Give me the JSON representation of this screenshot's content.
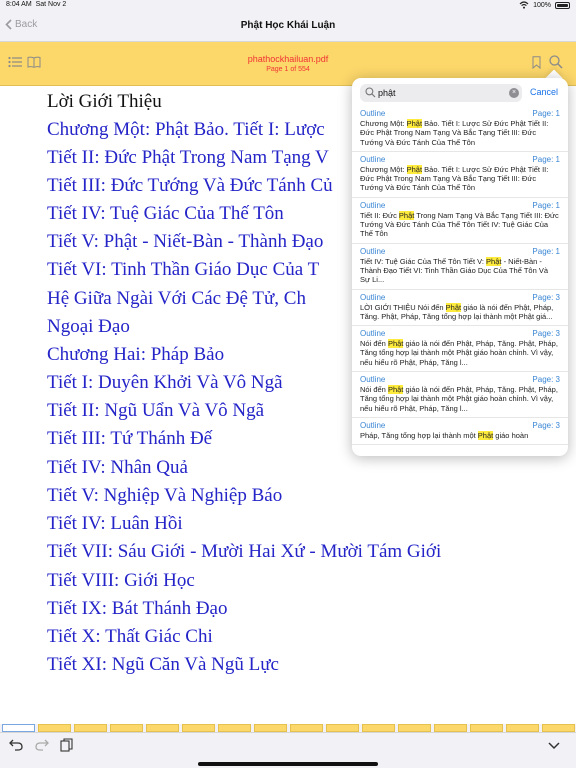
{
  "status_bar": {
    "time": "8:04 AM",
    "date": "Sat Nov 2",
    "battery": "100%"
  },
  "nav": {
    "back_label": "Back",
    "title": "Phật Học Khái Luận"
  },
  "pdf_toolbar": {
    "file_name": "phathockhailuan.pdf",
    "page_indicator": "Page 1 of 554"
  },
  "document": {
    "lines": [
      "Lời Giới Thiệu",
      "Chương Một: Phật Bảo. Tiết I: Lược",
      "Tiết II: Đức Phật Trong Nam Tạng V",
      "Tiết III: Đức Tướng Và Đức Tánh Củ",
      "Tiết IV: Tuệ Giác Của Thế Tôn",
      "Tiết V: Phật - Niết-Bàn - Thành Đạo",
      "Tiết VI: Tinh Thần Giáo Dục Của T",
      "Hệ Giữa Ngài Với Các Đệ Tử, Ch",
      "Ngoại Đạo",
      "Chương Hai: Pháp Bảo",
      "Tiết I: Duyên Khởi Và Vô Ngã",
      "Tiết II: Ngũ Uẩn Và Vô Ngã",
      "Tiết III: Tứ Thánh Đế",
      "Tiết IV: Nhân Quả",
      "Tiết V: Nghiệp Và Nghiệp Báo",
      "Tiết IV: Luân Hồi",
      "Tiết VII: Sáu Giới - Mười Hai Xứ - Mười Tám Giới",
      "Tiết VIII: Giới Học",
      "Tiết IX: Bát Thánh Đạo",
      "Tiết X: Thất Giác Chi",
      "Tiết XI: Ngũ Căn Và Ngũ Lực"
    ]
  },
  "search": {
    "query": "phật",
    "cancel_label": "Cancel",
    "results": [
      {
        "source": "Outline",
        "page": "Page: 1",
        "before": "Chương Một: ",
        "match": "Phật",
        "after": " Bảo. Tiết I: Lược Sử Đức Phật Tiết II: Đức Phật Trong Nam Tạng Và Bắc Tạng Tiết III: Đức Tướng Và Đức Tánh Của Thế Tôn"
      },
      {
        "source": "Outline",
        "page": "Page: 1",
        "before": "Chương Một: ",
        "match": "Phật",
        "after": " Bảo. Tiết I: Lược Sử Đức Phật Tiết II: Đức Phật Trong Nam Tạng Và Bắc Tạng Tiết III: Đức Tướng Và Đức Tánh Của Thế Tôn"
      },
      {
        "source": "Outline",
        "page": "Page: 1",
        "before": "Tiết II: Đức ",
        "match": "Phật",
        "after": " Trong Nam Tạng Và Bắc Tạng Tiết III: Đức Tướng Và Đức Tánh Của Thế Tôn Tiết IV: Tuệ Giác Của Thế Tôn"
      },
      {
        "source": "Outline",
        "page": "Page: 1",
        "before": "Tiết IV: Tuệ Giác Của Thế Tôn Tiết V: ",
        "match": "Phật",
        "after": " - Niết-Bàn - Thành Đạo Tiết VI: Tinh Thần Giáo Dục Của Thế Tôn Và Sự Li..."
      },
      {
        "source": "Outline",
        "page": "Page: 3",
        "before": "LỜI GIỚI THIỆU Nói đến ",
        "match": "Phật",
        "after": " giáo là nói đến Phật, Pháp, Tăng. Phật, Pháp, Tăng tổng hợp lại thành một Phật giá..."
      },
      {
        "source": "Outline",
        "page": "Page: 3",
        "before": "Nói đến ",
        "match": "Phật",
        "after": " giáo là nói đến Phật, Pháp, Tăng. Phật, Pháp, Tăng tổng hợp lại thành một Phật giáo hoàn chỉnh. Vì vậy, nếu hiểu rõ Phật, Pháp, Tăng l..."
      },
      {
        "source": "Outline",
        "page": "Page: 3",
        "before": "Nói đến ",
        "match": "Phật",
        "after": " giáo là nói đến Phật, Pháp, Tăng. Phật, Pháp, Tăng tổng hợp lại thành một Phật giáo hoàn chỉnh. Vì vậy, nếu hiểu rõ Phật, Pháp, Tăng l..."
      },
      {
        "source": "Outline",
        "page": "Page: 3",
        "before": "Pháp, Tăng tổng hợp lại thành một ",
        "match": "Phật",
        "after": " giáo hoàn"
      }
    ]
  },
  "colors": {
    "toolbar": "#fcd76a",
    "file_name": "#f03434",
    "link_text": "#2424c8",
    "highlight": "#ffeb3b",
    "accent": "#1a73e8"
  }
}
